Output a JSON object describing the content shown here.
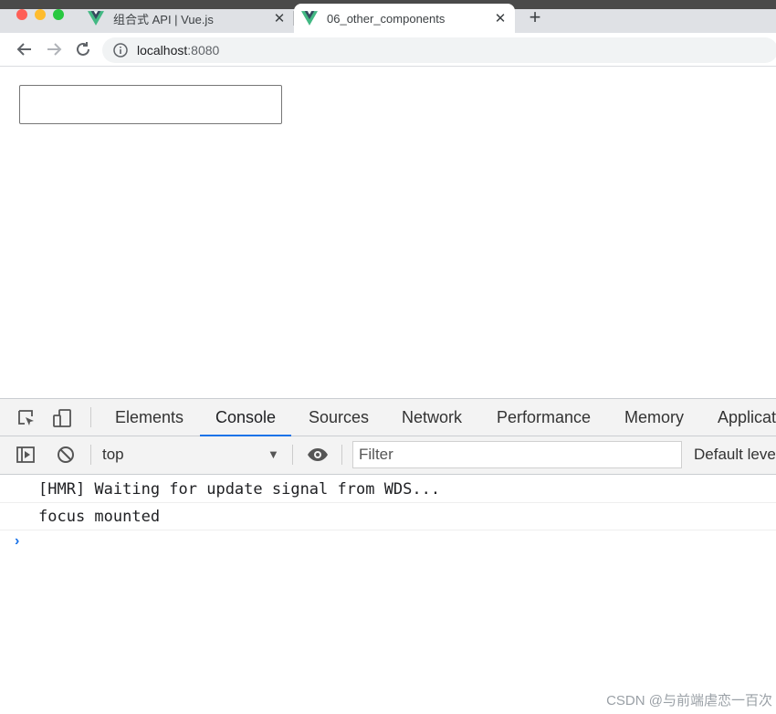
{
  "browser": {
    "tabs": [
      {
        "title": "组合式 API | Vue.js",
        "close": "✕"
      },
      {
        "title": "06_other_components",
        "close": "✕"
      }
    ],
    "new_tab": "+",
    "url_host": "localhost",
    "url_port": ":8080"
  },
  "devtools": {
    "tabs": [
      "Elements",
      "Console",
      "Sources",
      "Network",
      "Performance",
      "Memory",
      "Applicat"
    ],
    "active_tab": "Console",
    "context": "top",
    "filter_placeholder": "Filter",
    "levels": "Default leve",
    "messages": [
      "[HMR] Waiting for update signal from WDS...",
      "focus mounted"
    ],
    "prompt": "›"
  },
  "watermark": "CSDN @与前端虐恋一百次",
  "colors": {
    "vue_green": "#42b883",
    "vue_dark": "#35495e",
    "accent": "#1a73e8"
  }
}
